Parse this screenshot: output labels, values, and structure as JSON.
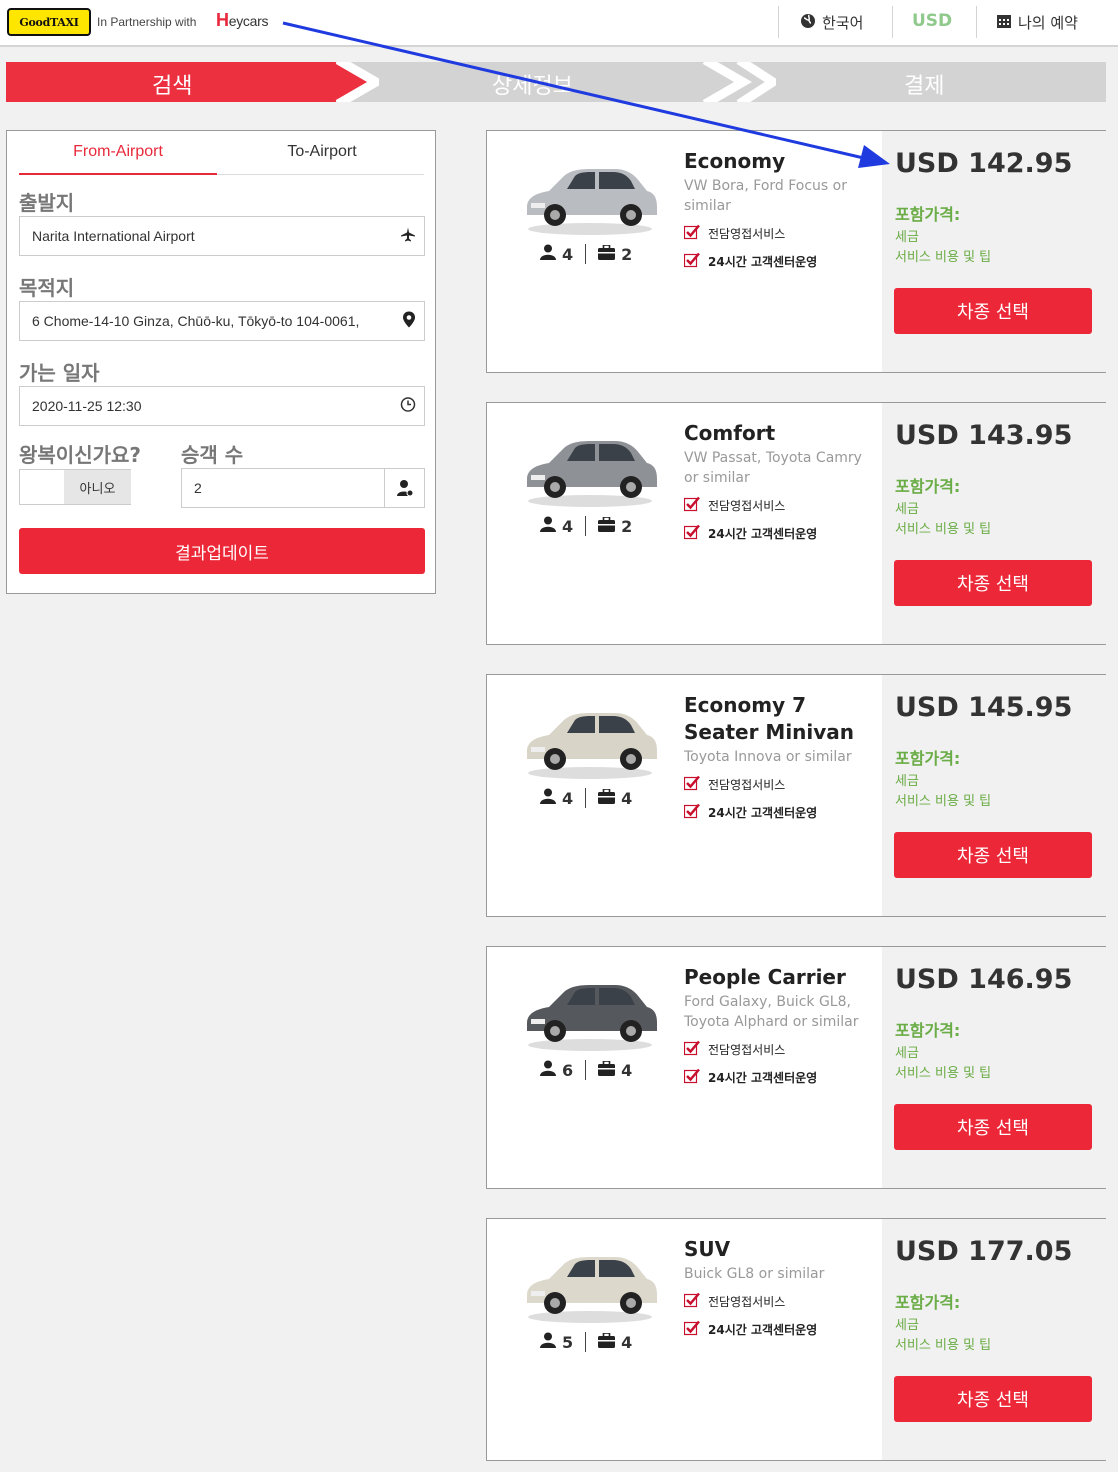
{
  "header": {
    "logo": "GoodTAXI",
    "partnership": "In Partnership with",
    "partner_brand_h": "H",
    "partner_brand_rest": "eycars",
    "language": "한국어",
    "currency": "USD",
    "my_booking": "나의 예약"
  },
  "steps": [
    {
      "label": "검색",
      "active": true
    },
    {
      "label": "상세정보",
      "active": false
    },
    {
      "label": "결제",
      "active": false
    }
  ],
  "search": {
    "tabs": [
      {
        "label": "From-Airport",
        "active": true
      },
      {
        "label": "To-Airport",
        "active": false
      }
    ],
    "origin_label": "출발지",
    "origin_value": "Narita International Airport",
    "destination_label": "목적지",
    "destination_value": "6 Chome-14-10 Ginza, Chūō-ku, Tōkyō-to 104-0061,",
    "date_label": "가는 일자",
    "date_value": "2020-11-25 12:30",
    "roundtrip_label": "왕복이신가요?",
    "roundtrip_value": "아니오",
    "passengers_label": "승객 수",
    "passengers_value": "2",
    "update_button": "결과업데이트"
  },
  "common": {
    "feature_1": "전담영접서비스",
    "feature_2": "24시간 고객센터운영",
    "included_title": "포함가격:",
    "included_1": "세금",
    "included_2": "서비스 비용 및 팁",
    "select_button": "차종 선택"
  },
  "vehicles": [
    {
      "name": "Economy",
      "desc": "VW Bora, Ford Focus or similar",
      "passengers": "4",
      "luggage": "2",
      "price": "USD 142.95",
      "color": "#b9bcc0"
    },
    {
      "name": "Comfort",
      "desc": "VW Passat, Toyota Camry or similar",
      "passengers": "4",
      "luggage": "2",
      "price": "USD 143.95",
      "color": "#8e9196"
    },
    {
      "name": "Economy 7 Seater Minivan",
      "desc": "Toyota Innova or similar",
      "passengers": "4",
      "luggage": "4",
      "price": "USD 145.95",
      "color": "#d8d4c8"
    },
    {
      "name": "People Carrier",
      "desc": "Ford Galaxy, Buick GL8, Toyota Alphard or similar",
      "passengers": "6",
      "luggage": "4",
      "price": "USD 146.95",
      "color": "#55585c"
    },
    {
      "name": "SUV",
      "desc": "Buick GL8 or similar",
      "passengers": "5",
      "luggage": "4",
      "price": "USD 177.05",
      "color": "#dcd8cc"
    }
  ],
  "colors": {
    "accent": "#ec2737",
    "included_green": "#6aac45",
    "annotation_arrow": "#1f3be0"
  }
}
